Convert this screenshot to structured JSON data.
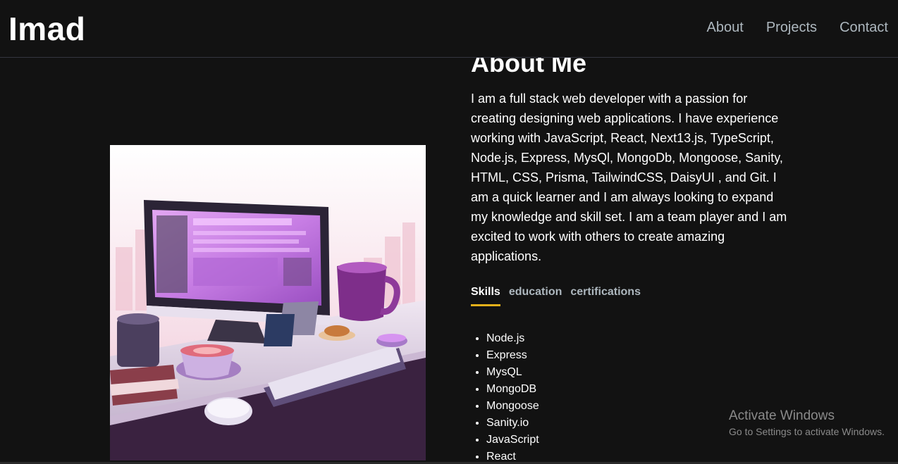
{
  "navbar": {
    "brand": "Imad",
    "links": [
      "About",
      "Projects",
      "Contact"
    ]
  },
  "about": {
    "title": "About Me",
    "description": "I am a full stack web developer with a passion for creating designing web applications. I have experience working with JavaScript, React, Next13.js, TypeScript, Node.js, Express, MysQl, MongoDb, Mongoose, Sanity, HTML, CSS, Prisma, TailwindCSS, DaisyUI , and Git. I am a quick learner and I am always looking to expand my knowledge and skill set. I am a team player and I am excited to work with others to create amazing applications.",
    "tabs": [
      "Skills",
      "education",
      "certifications"
    ],
    "active_tab": "Skills",
    "skills": [
      "Node.js",
      "Express",
      "MysQL",
      "MongoDB",
      "Mongoose",
      "Sanity.io",
      "JavaScript",
      "React"
    ]
  },
  "watermark": {
    "title": "Activate Windows",
    "subtitle": "Go to Settings to activate Windows."
  },
  "colors": {
    "background": "#121212",
    "tab_underline": "#e3b01a",
    "muted_text": "#adb7be"
  }
}
